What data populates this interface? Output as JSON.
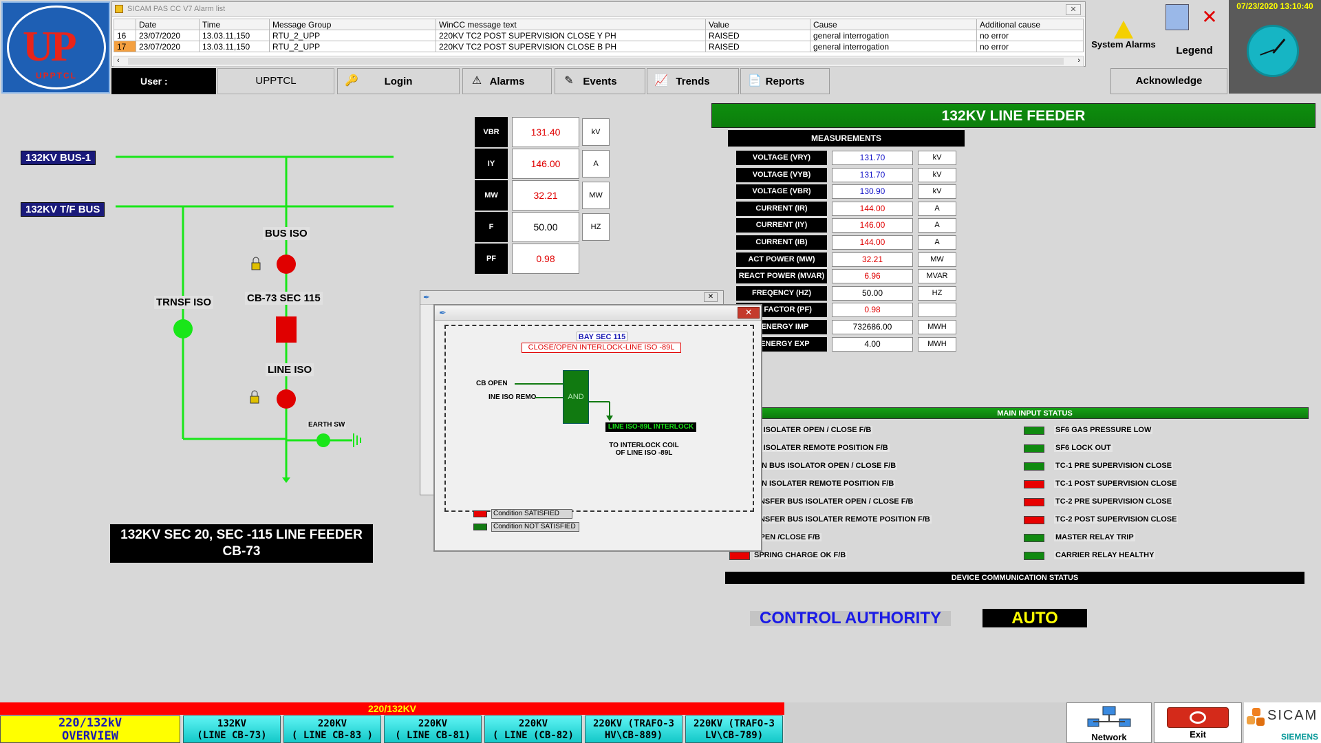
{
  "header": {
    "logo_text": "UP",
    "logo_sub": "UPPTCL",
    "alarm_window_title": "SICAM PAS CC V7 Alarm list",
    "alarm_columns": [
      "",
      "Date",
      "Time",
      "Message Group",
      "WinCC message text",
      "Value",
      "Cause",
      "Additional cause"
    ],
    "alarm_rows": [
      [
        "16",
        "23/07/2020",
        "13.03.11,150",
        "RTU_2_UPP",
        "220KV TC2 POST SUPERVISION CLOSE Y PH",
        "RAISED",
        "general interrogation",
        "no error"
      ],
      [
        "17",
        "23/07/2020",
        "13.03.11,150",
        "RTU_2_UPP",
        "220KV TC2 POST SUPERVISION CLOSE B PH",
        "RAISED",
        "general interrogation",
        "no error"
      ]
    ],
    "user_label": "User :",
    "user_value": "UPPTCL",
    "login": "Login",
    "alarms": "Alarms",
    "events": "Events",
    "trends": "Trends",
    "reports": "Reports",
    "system_alarms": "System Alarms",
    "legend": "Legend",
    "acknowledge": "Acknowledge",
    "datetime": "07/23/2020 13:10:40"
  },
  "sld": {
    "bus1": "132KV BUS-1",
    "bus2": "132KV T/F BUS",
    "bus_iso": "BUS ISO",
    "cb": "CB-73 SEC 115",
    "line_iso": "LINE ISO",
    "trnsf_iso": "TRNSF ISO",
    "earth_sw": "EARTH SW",
    "feeder_title_1": "132KV SEC 20, SEC -115 LINE FEEDER",
    "feeder_title_2": "CB-73",
    "colors": {
      "line": "#19e619",
      "open": "#e00000",
      "closed": "#19e619"
    }
  },
  "mini": [
    {
      "label": "VBR",
      "value": "131.40",
      "unit": "kV",
      "color": "#e00000"
    },
    {
      "label": "IY",
      "value": "146.00",
      "unit": "A",
      "color": "#e00000"
    },
    {
      "label": "MW",
      "value": "32.21",
      "unit": "MW",
      "color": "#e00000"
    },
    {
      "label": "F",
      "value": "50.00",
      "unit": "HZ",
      "color": "#000000"
    },
    {
      "label": "PF",
      "value": "0.98",
      "unit": "",
      "color": "#e00000"
    }
  ],
  "right": {
    "title": "132KV LINE FEEDER",
    "measurements_hdr": "MEASUREMENTS",
    "rows": [
      {
        "label": "VOLTAGE (VRY)",
        "value": "131.70",
        "unit": "kV",
        "color": "blue"
      },
      {
        "label": "VOLTAGE (VYB)",
        "value": "131.70",
        "unit": "kV",
        "color": "blue"
      },
      {
        "label": "VOLTAGE (VBR)",
        "value": "130.90",
        "unit": "kV",
        "color": "blue"
      },
      {
        "label": "CURRENT (IR)",
        "value": "144.00",
        "unit": "A",
        "color": "red"
      },
      {
        "label": "CURRENT (IY)",
        "value": "146.00",
        "unit": "A",
        "color": "red"
      },
      {
        "label": "CURRENT (IB)",
        "value": "144.00",
        "unit": "A",
        "color": "red"
      },
      {
        "label": "ACT POWER (MW)",
        "value": "32.21",
        "unit": "MW",
        "color": "red"
      },
      {
        "label": "REACT POWER (MVAR)",
        "value": "6.96",
        "unit": "MVAR",
        "color": "red"
      },
      {
        "label": "FREQENCY (HZ)",
        "value": "50.00",
        "unit": "HZ",
        "color": "blk"
      },
      {
        "label": "ER FACTOR (PF)",
        "value": "0.98",
        "unit": "",
        "color": "red"
      },
      {
        "label": "T ENERGY IMP",
        "value": "732686.00",
        "unit": "MWH",
        "color": "blk"
      },
      {
        "label": "T ENERGY EXP",
        "value": "4.00",
        "unit": "MWH",
        "color": "blk"
      }
    ],
    "main_input_hdr": "MAIN INPUT STATUS",
    "status_left": [
      {
        "text": "IE ISOLATER OPEN / CLOSE  F/B",
        "state": "green"
      },
      {
        "text": "IE ISOLATER REMOTE POSITION F/B",
        "state": "green"
      },
      {
        "text": "AIN BUS ISOLATOR OPEN / CLOSE F/B",
        "state": "green"
      },
      {
        "text": "AIN ISOLATER REMOTE POSITION F/B",
        "state": "green"
      },
      {
        "text": "ANSFER BUS  ISOLATER OPEN / CLOSE F/B",
        "state": "green"
      },
      {
        "text": "ANSFER BUS ISOLATER REMOTE POSITION F/B",
        "state": "green"
      },
      {
        "text": "OPEN /CLOSE F/B",
        "state": "green"
      },
      {
        "text": "SPRING CHARGE OK F/B",
        "state": "red"
      }
    ],
    "status_right": [
      {
        "text": "SF6 GAS PRESSURE LOW",
        "state": "green"
      },
      {
        "text": "SF6 LOCK OUT",
        "state": "green"
      },
      {
        "text": "TC-1 PRE SUPERVISION CLOSE",
        "state": "green"
      },
      {
        "text": "TC-1 POST SUPERVISION CLOSE",
        "state": "red"
      },
      {
        "text": "TC-2 PRE SUPERVISION CLOSE",
        "state": "red"
      },
      {
        "text": "TC-2 POST SUPERVISION CLOSE",
        "state": "red"
      },
      {
        "text": "MASTER RELAY TRIP",
        "state": "green"
      },
      {
        "text": "CARRIER RELAY HEALTHY",
        "state": "green"
      }
    ],
    "device_comm": "DEVICE COMMUNICATION STATUS",
    "control_authority": "CONTROL AUTHORITY",
    "auto": "AUTO"
  },
  "popup": {
    "bay": "BAY SEC 115",
    "interlock_title": "CLOSE/OPEN INTERLOCK-LINE ISO -89L",
    "in1": "CB OPEN",
    "in2": "INE ISO REMO",
    "gate": "AND",
    "output": "LINE ISO-89L INTERLOCK",
    "note1": "TO INTERLOCK COIL",
    "note2": "OF LINE ISO -89L",
    "cond_sat": "Condition SATISFIED",
    "cond_not": "Condition NOT SATISFIED"
  },
  "nav": {
    "top": "220/132KV",
    "overview_1": "220/132kV",
    "overview_2": "OVERVIEW",
    "buttons": [
      {
        "l1": "132KV",
        "l2": "(LINE CB-73)"
      },
      {
        "l1": "220KV",
        "l2": "( LINE CB-83 )"
      },
      {
        "l1": "220KV",
        "l2": "( LINE  CB-81)"
      },
      {
        "l1": "220KV",
        "l2": "( LINE (CB-82)"
      },
      {
        "l1": "220KV (TRAFO-3",
        "l2": "HV\\CB-889)"
      },
      {
        "l1": "220KV (TRAFO-3",
        "l2": "LV\\CB-789)"
      }
    ],
    "network": "Network",
    "exit": "Exit",
    "sicam": "SICAM",
    "siemens": "SIEMENS"
  }
}
